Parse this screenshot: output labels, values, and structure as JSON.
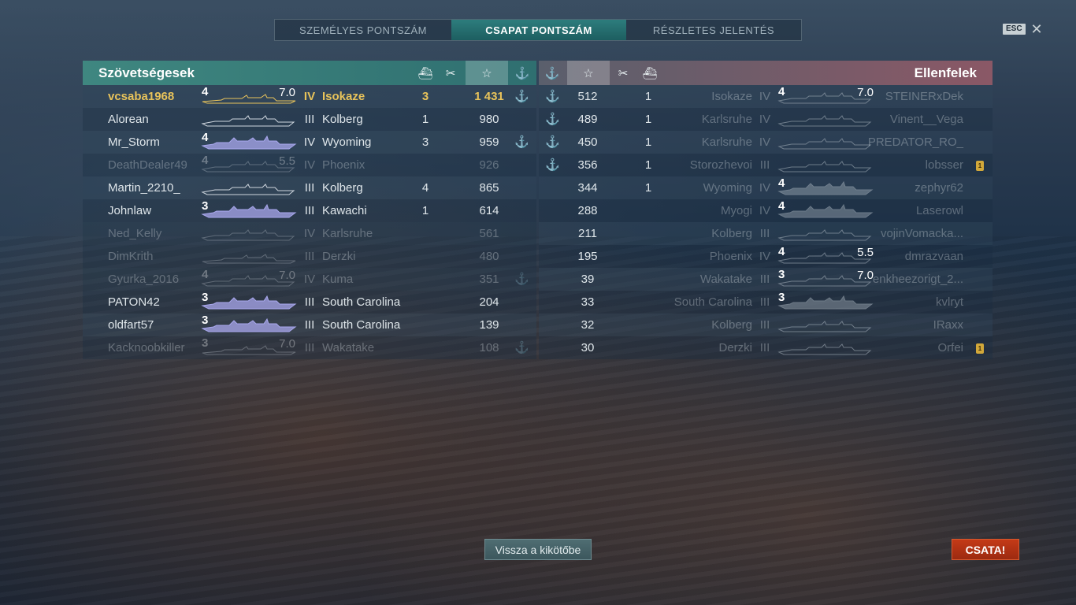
{
  "tabs": [
    {
      "label": "SZEMÉLYES PONTSZÁM",
      "active": false
    },
    {
      "label": "CSAPAT PONTSZÁM",
      "active": true
    },
    {
      "label": "RÉSZLETES JELENTÉS",
      "active": false
    }
  ],
  "esc_label": "ESC",
  "close_glyph": "✕",
  "allies": {
    "title": "Szövetségesek",
    "rows": [
      {
        "name": "vcsaba1968",
        "lvl_a": "4",
        "lvl_b": "7.0",
        "tier": "IV",
        "ship": "Isokaze",
        "kills": "3",
        "score": "1 431",
        "base": "⚓",
        "state": "self",
        "class": "dd"
      },
      {
        "name": "Alorean",
        "lvl_a": "",
        "lvl_b": "",
        "tier": "III",
        "ship": "Kolberg",
        "kills": "1",
        "score": "980",
        "base": "",
        "state": "alive",
        "class": "cl"
      },
      {
        "name": "Mr_Storm",
        "lvl_a": "4",
        "lvl_b": "",
        "tier": "IV",
        "ship": "Wyoming",
        "kills": "3",
        "score": "959",
        "base": "⚓",
        "state": "alive",
        "class": "bb"
      },
      {
        "name": "DeathDealer49",
        "lvl_a": "4",
        "lvl_b": "5.5",
        "tier": "IV",
        "ship": "Phoenix",
        "kills": "",
        "score": "926",
        "base": "",
        "state": "dead",
        "class": "cl"
      },
      {
        "name": "Martin_2210_",
        "lvl_a": "",
        "lvl_b": "",
        "tier": "III",
        "ship": "Kolberg",
        "kills": "4",
        "score": "865",
        "base": "",
        "state": "alive",
        "class": "cl"
      },
      {
        "name": "Johnlaw",
        "lvl_a": "3",
        "lvl_b": "",
        "tier": "III",
        "ship": "Kawachi",
        "kills": "1",
        "score": "614",
        "base": "",
        "state": "alive",
        "class": "bb"
      },
      {
        "name": "Ned_Kelly",
        "lvl_a": "",
        "lvl_b": "",
        "tier": "IV",
        "ship": "Karlsruhe",
        "kills": "",
        "score": "561",
        "base": "",
        "state": "dead",
        "class": "cl"
      },
      {
        "name": "DimKrith",
        "lvl_a": "",
        "lvl_b": "",
        "tier": "III",
        "ship": "Derzki",
        "kills": "",
        "score": "480",
        "base": "",
        "state": "dead",
        "class": "dd"
      },
      {
        "name": "Gyurka_2016",
        "lvl_a": "4",
        "lvl_b": "7.0",
        "tier": "IV",
        "ship": "Kuma",
        "kills": "",
        "score": "351",
        "base": "⚓",
        "state": "dead",
        "class": "cl"
      },
      {
        "name": "PATON42",
        "lvl_a": "3",
        "lvl_b": "",
        "tier": "III",
        "ship": "South Carolina",
        "kills": "",
        "score": "204",
        "base": "",
        "state": "alive",
        "class": "bb"
      },
      {
        "name": "oldfart57",
        "lvl_a": "3",
        "lvl_b": "",
        "tier": "III",
        "ship": "South Carolina",
        "kills": "",
        "score": "139",
        "base": "",
        "state": "alive",
        "class": "bb"
      },
      {
        "name": "Kacknoobkiller",
        "lvl_a": "3",
        "lvl_b": "7.0",
        "tier": "III",
        "ship": "Wakatake",
        "kills": "",
        "score": "108",
        "base": "⚓",
        "state": "dead",
        "class": "dd"
      }
    ]
  },
  "enemies": {
    "title": "Ellenfelek",
    "rows": [
      {
        "name": "STEINERxDek",
        "lvl_a": "4",
        "lvl_b": "7.0",
        "tier": "IV",
        "ship": "Isokaze",
        "kills": "1",
        "score": "512",
        "base": "⚓",
        "state": "dead",
        "badge": ""
      },
      {
        "name": "Vinent__Vega",
        "lvl_a": "",
        "lvl_b": "",
        "tier": "IV",
        "ship": "Karlsruhe",
        "kills": "1",
        "score": "489",
        "base": "⚓",
        "state": "dead",
        "badge": ""
      },
      {
        "name": "PREDATOR_RO_",
        "lvl_a": "",
        "lvl_b": "",
        "tier": "IV",
        "ship": "Karlsruhe",
        "kills": "1",
        "score": "450",
        "base": "⚓",
        "state": "dead",
        "badge": ""
      },
      {
        "name": "lobsser",
        "lvl_a": "",
        "lvl_b": "",
        "tier": "III",
        "ship": "Storozhevoi",
        "kills": "1",
        "score": "356",
        "base": "⚓",
        "state": "dead",
        "badge": "1"
      },
      {
        "name": "zephyr62",
        "lvl_a": "4",
        "lvl_b": "",
        "tier": "IV",
        "ship": "Wyoming",
        "kills": "1",
        "score": "344",
        "base": "",
        "state": "dead",
        "badge": ""
      },
      {
        "name": "Laserowl",
        "lvl_a": "4",
        "lvl_b": "",
        "tier": "IV",
        "ship": "Myogi",
        "kills": "",
        "score": "288",
        "base": "",
        "state": "dead",
        "badge": ""
      },
      {
        "name": "vojinVomacka...",
        "lvl_a": "",
        "lvl_b": "",
        "tier": "III",
        "ship": "Kolberg",
        "kills": "",
        "score": "211",
        "base": "",
        "state": "dead",
        "badge": ""
      },
      {
        "name": "dmrazvaan",
        "lvl_a": "4",
        "lvl_b": "5.5",
        "tier": "IV",
        "ship": "Phoenix",
        "kills": "",
        "score": "195",
        "base": "",
        "state": "dead",
        "badge": ""
      },
      {
        "name": "enkheezorigt_2...",
        "lvl_a": "3",
        "lvl_b": "7.0",
        "tier": "III",
        "ship": "Wakatake",
        "kills": "",
        "score": "39",
        "base": "",
        "state": "dead",
        "badge": ""
      },
      {
        "name": "kvlryt",
        "lvl_a": "3",
        "lvl_b": "",
        "tier": "III",
        "ship": "South Carolina",
        "kills": "",
        "score": "33",
        "base": "",
        "state": "dead",
        "badge": ""
      },
      {
        "name": "IRaxx",
        "lvl_a": "",
        "lvl_b": "",
        "tier": "III",
        "ship": "Kolberg",
        "kills": "",
        "score": "32",
        "base": "",
        "state": "dead",
        "badge": ""
      },
      {
        "name": "Orfei",
        "lvl_a": "",
        "lvl_b": "",
        "tier": "III",
        "ship": "Derzki",
        "kills": "",
        "score": "30",
        "base": "",
        "state": "dead",
        "badge": "1"
      }
    ]
  },
  "header_icons": {
    "ship_glyph": "⛴",
    "kills_glyph": "✂",
    "score_glyph": "☆",
    "base_glyph": "⚓"
  },
  "buttons": {
    "port": "Vissza a kikötőbe",
    "battle": "CSATA!"
  },
  "colors": {
    "self": "#e8c35a",
    "ally_header": "#3f8780",
    "enemy_header": "#8a5866",
    "battle_button": "#c43a17",
    "anchor": "#d3a641"
  }
}
